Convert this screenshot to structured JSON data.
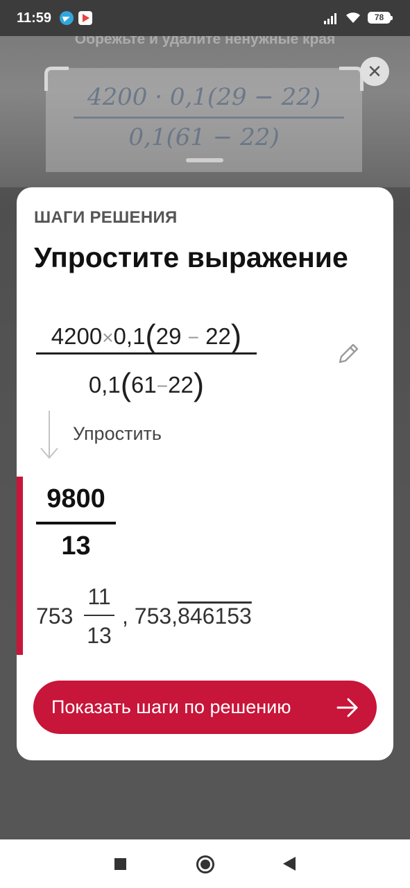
{
  "status_bar": {
    "time": "11:59",
    "battery": "78",
    "notification_icons": [
      "telegram-icon",
      "play-store-icon"
    ],
    "system_icons": [
      "signal-icon",
      "wifi-icon",
      "battery-icon"
    ]
  },
  "camera": {
    "crop_hint": "Обрежьте и удалите ненужные края",
    "photo_numerator": "4200 · 0,1(29 − 22)",
    "photo_denominator": "0,1(61 − 22)",
    "close_icon": "close-icon"
  },
  "card": {
    "section_label": "ШАГИ РЕШЕНИЯ",
    "title": "Упростите выражение",
    "problem": {
      "numerator": {
        "a": "4200",
        "times": "×",
        "b": "0,1",
        "open": "(",
        "c": "29",
        "minus": "−",
        "d": "22",
        "close": ")"
      },
      "denominator": {
        "a": "0,1",
        "open": "(",
        "c": "61",
        "minus": "−",
        "d": "22",
        "close": ")"
      }
    },
    "edit_icon": "pencil-icon",
    "step_label": "Упростить",
    "result": {
      "numerator": "9800",
      "denominator": "13"
    },
    "mixed": {
      "whole": "753",
      "numerator": "11",
      "denominator": "13",
      "decimal_prefix": ", 753,",
      "decimal_repeating": "846153"
    },
    "cta_label": "Показать шаги по решению",
    "accent_color": "#c8153a"
  },
  "nav_bar": {
    "icons": [
      "recents-square-icon",
      "home-circle-icon",
      "back-triangle-icon"
    ]
  }
}
